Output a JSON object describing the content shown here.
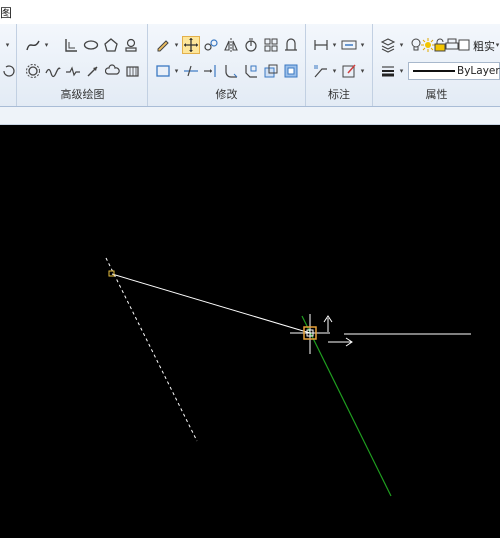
{
  "window": {
    "title_fragment": "图"
  },
  "ribbon": {
    "panels": [
      {
        "id": "advanced_draw",
        "label": "高级绘图"
      },
      {
        "id": "modify",
        "label": "修改"
      },
      {
        "id": "annotate",
        "label": "标注"
      },
      {
        "id": "properties",
        "label": "属性"
      }
    ],
    "properties": {
      "layer_label": "粗实",
      "linetype_value": "ByLayer"
    }
  },
  "colors": {
    "canvas": "#000000",
    "accent_active": "#fde69a",
    "selection_line": "#ffffff",
    "preview_line": "#1f9e1f",
    "marker": "#e8a23a"
  },
  "canvas": {
    "cursor": "crosshair-with-snap-marker"
  }
}
